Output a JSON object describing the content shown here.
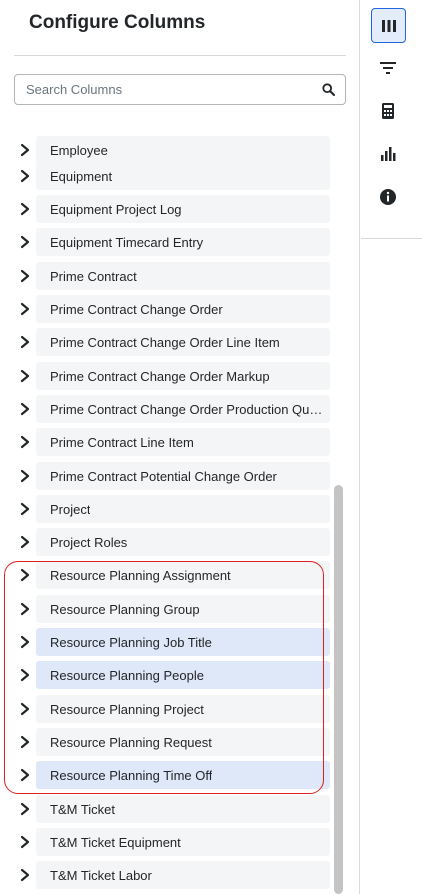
{
  "panel": {
    "title": "Configure Columns",
    "search": {
      "placeholder": "Search Columns",
      "value": ""
    }
  },
  "list": {
    "items": [
      {
        "label": "Employee",
        "selected": false
      },
      {
        "label": "Equipment",
        "selected": false
      },
      {
        "label": "Equipment Project Log",
        "selected": false
      },
      {
        "label": "Equipment Timecard Entry",
        "selected": false
      },
      {
        "label": "Prime Contract",
        "selected": false
      },
      {
        "label": "Prime Contract Change Order",
        "selected": false
      },
      {
        "label": "Prime Contract Change Order Line Item",
        "selected": false
      },
      {
        "label": "Prime Contract Change Order Markup",
        "selected": false
      },
      {
        "label": "Prime Contract Change Order Production Qua...",
        "selected": false
      },
      {
        "label": "Prime Contract Line Item",
        "selected": false
      },
      {
        "label": "Prime Contract Potential Change Order",
        "selected": false
      },
      {
        "label": "Project",
        "selected": false
      },
      {
        "label": "Project Roles",
        "selected": false
      },
      {
        "label": "Resource Planning Assignment",
        "selected": false
      },
      {
        "label": "Resource Planning Group",
        "selected": false
      },
      {
        "label": "Resource Planning Job Title",
        "selected": true
      },
      {
        "label": "Resource Planning People",
        "selected": true
      },
      {
        "label": "Resource Planning Project",
        "selected": false
      },
      {
        "label": "Resource Planning Request",
        "selected": false
      },
      {
        "label": "Resource Planning Time Off",
        "selected": true
      },
      {
        "label": "T&M Ticket",
        "selected": false
      },
      {
        "label": "T&M Ticket Equipment",
        "selected": false
      },
      {
        "label": "T&M Ticket Labor",
        "selected": false
      }
    ]
  },
  "rail": {
    "buttons": [
      {
        "icon": "columns-icon",
        "active": true
      },
      {
        "icon": "filter-icon",
        "active": false
      },
      {
        "icon": "calculator-icon",
        "active": false
      },
      {
        "icon": "bar-chart-icon",
        "active": false
      },
      {
        "icon": "info-icon",
        "active": false
      }
    ]
  },
  "colors": {
    "selected_row": "#dfe8f8",
    "row": "#f4f5f6",
    "active_accent": "#2066df",
    "annotation": "#e02020"
  }
}
